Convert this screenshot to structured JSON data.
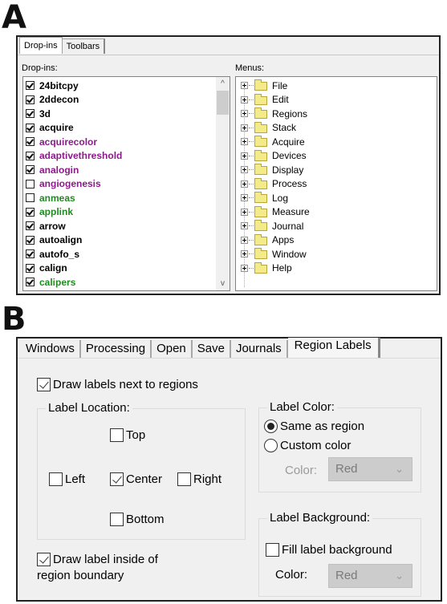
{
  "figure_labels": {
    "a": "A",
    "b": "B"
  },
  "panel_a": {
    "tabs": [
      {
        "label": "Drop-ins",
        "active": true
      },
      {
        "label": "Toolbars",
        "active": false
      }
    ],
    "dropins_label": "Drop-ins:",
    "menus_label": "Menus:",
    "dropins": [
      {
        "name": "24bitcpy",
        "checked": true,
        "color": "#000000"
      },
      {
        "name": "2ddecon",
        "checked": true,
        "color": "#000000"
      },
      {
        "name": "3d",
        "checked": true,
        "color": "#000000"
      },
      {
        "name": "acquire",
        "checked": true,
        "color": "#000000"
      },
      {
        "name": "acquirecolor",
        "checked": true,
        "color": "#8b1a8b"
      },
      {
        "name": "adaptivethreshold",
        "checked": true,
        "color": "#8b1a8b"
      },
      {
        "name": "analogin",
        "checked": true,
        "color": "#8b1a8b"
      },
      {
        "name": "angiogenesis",
        "checked": false,
        "color": "#8b1a8b"
      },
      {
        "name": "anmeas",
        "checked": false,
        "color": "#1e8c1e"
      },
      {
        "name": "applink",
        "checked": true,
        "color": "#1e8c1e"
      },
      {
        "name": "arrow",
        "checked": true,
        "color": "#000000"
      },
      {
        "name": "autoalign",
        "checked": true,
        "color": "#000000"
      },
      {
        "name": "autofo_s",
        "checked": true,
        "color": "#000000"
      },
      {
        "name": "calign",
        "checked": true,
        "color": "#000000"
      },
      {
        "name": "calipers",
        "checked": true,
        "color": "#1e8c1e"
      }
    ],
    "scroll": {
      "up_icon": "^",
      "down_icon": "v"
    },
    "menus": [
      "File",
      "Edit",
      "Regions",
      "Stack",
      "Acquire",
      "Devices",
      "Display",
      "Process",
      "Log",
      "Measure",
      "Journal",
      "Apps",
      "Window",
      "Help"
    ]
  },
  "panel_b": {
    "tabs": [
      {
        "label": "Windows",
        "active": false
      },
      {
        "label": "Processing",
        "active": false
      },
      {
        "label": "Open",
        "active": false
      },
      {
        "label": "Save",
        "active": false
      },
      {
        "label": "Journals",
        "active": false
      },
      {
        "label": "Region Labels",
        "active": true
      }
    ],
    "draw_labels": {
      "label": "Draw labels next to regions",
      "checked": true
    },
    "label_location": {
      "title": "Label Location:",
      "top": {
        "label": "Top",
        "checked": false
      },
      "left": {
        "label": "Left",
        "checked": false
      },
      "center": {
        "label": "Center",
        "checked": true
      },
      "right": {
        "label": "Right",
        "checked": false
      },
      "bottom": {
        "label": "Bottom",
        "checked": false
      }
    },
    "draw_inside": {
      "label_line1": "Draw label inside of",
      "label_line2": "region boundary",
      "checked": true
    },
    "label_color": {
      "title": "Label Color:",
      "same_as_region": {
        "label": "Same as region",
        "selected": true
      },
      "custom_color": {
        "label": "Custom color",
        "selected": false
      },
      "color_label": "Color:",
      "color_value": "Red",
      "enabled": false
    },
    "label_background": {
      "title": "Label Background:",
      "fill": {
        "label": "Fill label background",
        "checked": false
      },
      "color_label": "Color:",
      "color_value": "Red",
      "enabled": false
    },
    "chevron_icon": "⌄"
  }
}
